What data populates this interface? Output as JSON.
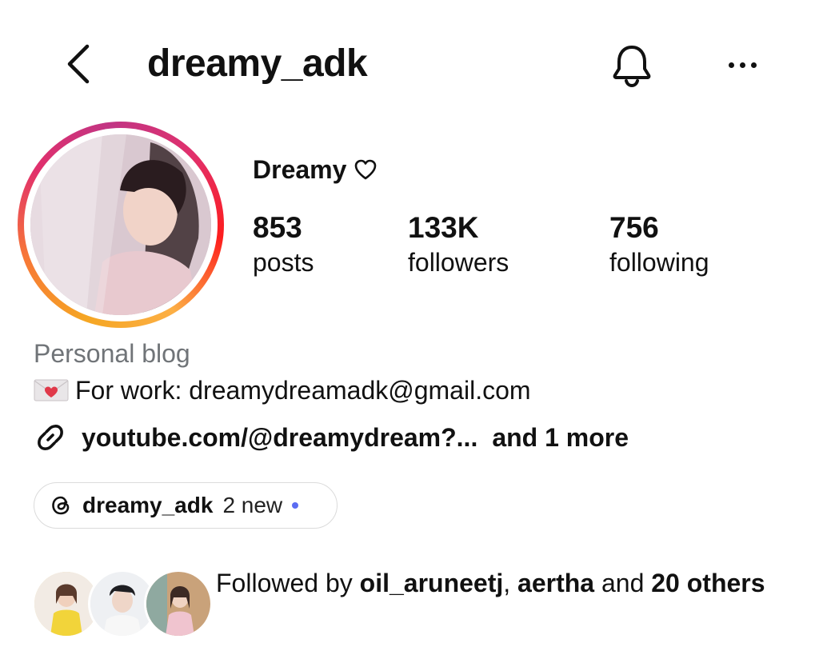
{
  "header": {
    "username": "dreamy_adk"
  },
  "profile": {
    "display_name": "Dreamy",
    "stats": [
      {
        "value": "853",
        "label": "posts"
      },
      {
        "value": "133K",
        "label": "followers"
      },
      {
        "value": "756",
        "label": "following"
      }
    ]
  },
  "bio": {
    "category": "Personal blog",
    "line1": "For work: dreamydreamadk@gmail.com",
    "link": "youtube.com/@dreamydream?...",
    "more_links": "and 1 more"
  },
  "threads": {
    "username": "dreamy_adk",
    "new_label": "2 new"
  },
  "followed_by": {
    "prefix": "Followed by ",
    "user1": "oil_aruneetj",
    "sep": ", ",
    "user2": "aertha",
    "and": " and ",
    "count": "20 others"
  },
  "colors": {
    "text": "#111111",
    "muted": "#707478",
    "threads_dot": "#5b6cf2",
    "chip_border": "#dbdbdb"
  },
  "icons": [
    "back-arrow-icon",
    "bell-icon",
    "more-dots-icon",
    "heart-outline-icon",
    "envelope-heart-icon",
    "link-icon",
    "threads-icon"
  ]
}
